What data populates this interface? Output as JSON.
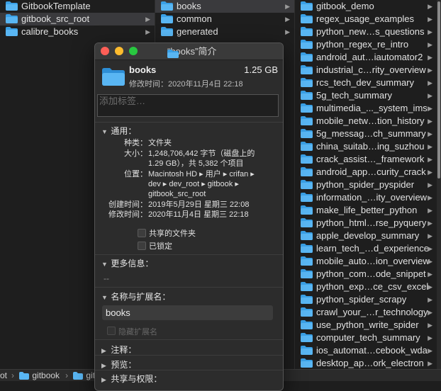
{
  "col1": [
    {
      "label": "GitbookTemplate",
      "selected": false
    },
    {
      "label": "gitbook_src_root",
      "selected": true
    },
    {
      "label": "calibre_books",
      "selected": false
    }
  ],
  "col2": [
    {
      "label": "books",
      "selected": true
    },
    {
      "label": "common",
      "selected": false
    },
    {
      "label": "generated",
      "selected": false
    }
  ],
  "col3": [
    "gitbook_demo",
    "regex_usage_examples",
    "python_new…s_questions",
    "python_regex_re_intro",
    "android_aut…iautomator2",
    "industrial_c…rity_overview",
    "rcs_tech_dev_summary",
    "5g_tech_summary",
    "multimedia_..._system_ims",
    "mobile_netw…tion_history",
    "5g_messag…ch_summary",
    "china_suitab…ing_suzhou",
    "crack_assist…_framework",
    "android_app…curity_crack",
    "python_spider_pyspider",
    "information_…ity_overview",
    "make_life_better_python",
    "python_html…rse_pyquery",
    "apple_develop_summary",
    "learn_tech_…d_experience",
    "mobile_auto…ion_overview",
    "python_com…ode_snippet",
    "python_exp…ce_csv_excel",
    "python_spider_scrapy",
    "crawl_your_…r_technology",
    "use_python_write_spider",
    "computer_tech_summary",
    "ios_automat…cebook_wda",
    "desktop_ap…ork_electron"
  ],
  "pathbar": {
    "p0": "ot",
    "p1": "gitbook",
    "p2": "gitt"
  },
  "info": {
    "title": "“books”简介",
    "name": "books",
    "size": "1.25 GB",
    "modified_line": "修改时间：2020年11月4日 22:18",
    "tags_placeholder": "添加标签…",
    "general": {
      "header": "通用：",
      "kind_k": "种类：",
      "kind_v": "文件夹",
      "size_k": "大小：",
      "size_v1": "1,248,706,442 字节（磁盘上的",
      "size_v2": "1.29 GB），共 5,382 个项目",
      "where_k": "位置：",
      "where_v1": "Macintosh HD ▸ 用户 ▸ crifan ▸",
      "where_v2": "dev ▸ dev_root ▸ gitbook ▸",
      "where_v3": "gitbook_src_root",
      "created_k": "创建时间：",
      "created_v": "2019年5月29日 星期三 22:08",
      "mod_k": "修改时间：",
      "mod_v": "2020年11月4日 星期三 22:18",
      "shared_label": "共享的文件夹",
      "locked_label": "已锁定"
    },
    "more": {
      "header": "更多信息：",
      "value": "--"
    },
    "name_ext": {
      "header": "名称与扩展名：",
      "value": "books",
      "hide_label": "隐藏扩展名"
    },
    "comments_header": "注释：",
    "preview_header": "预览：",
    "sharing_header": "共享与权限："
  }
}
